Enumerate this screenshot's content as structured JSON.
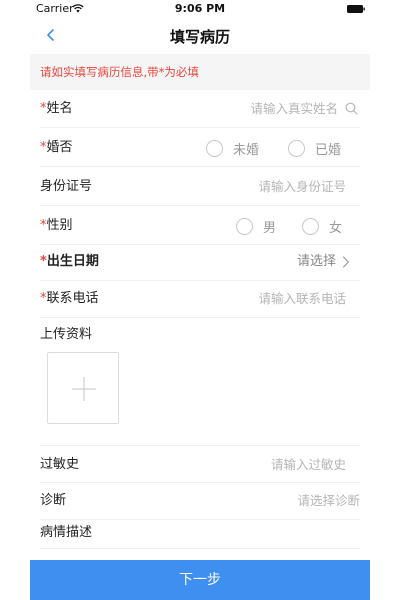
{
  "status_bar": {
    "carrier": "Carrier",
    "time": "9:06 PM"
  },
  "nav": {
    "title": "填写病历",
    "back_icon": "chevron-left-icon"
  },
  "notice": "请如实填写病历信息,带*为必填",
  "form": {
    "name": {
      "required": "*",
      "label": "姓名",
      "placeholder": "请输入真实姓名",
      "icon": "search-icon"
    },
    "marital": {
      "required": "*",
      "label": "婚否",
      "options": [
        "未婚",
        "已婚"
      ]
    },
    "id_card": {
      "label": "身份证号",
      "placeholder": "请输入身份证号"
    },
    "gender": {
      "required": "*",
      "label": "性别",
      "options": [
        "男",
        "女"
      ]
    },
    "birth": {
      "required": "*",
      "label": "出生日期",
      "value": "请选择",
      "icon": "chevron-right-icon"
    },
    "phone": {
      "required": "*",
      "label": "联系电话",
      "placeholder": "请输入联系电话"
    },
    "upload": {
      "label": "上传资料",
      "icon": "plus-icon"
    },
    "allergy": {
      "label": "过敏史",
      "placeholder": "请输入过敏史"
    },
    "diagnosis": {
      "label": "诊断",
      "placeholder": "请选择诊断"
    },
    "description": {
      "label": "病情描述"
    }
  },
  "footer": {
    "next_label": "下一步"
  },
  "colors": {
    "accent": "#3f8ff0",
    "required": "#e8453c",
    "placeholder": "#b5b5b5"
  }
}
